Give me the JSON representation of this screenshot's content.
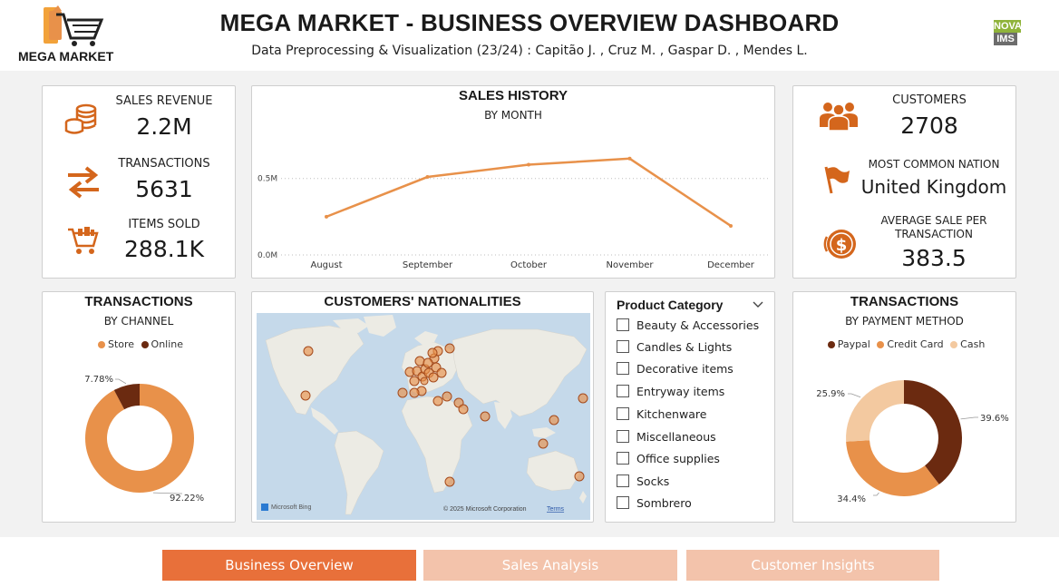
{
  "header": {
    "logo_text": "MEGA MARKET",
    "title": "MEGA MARKET - BUSINESS OVERVIEW DASHBOARD",
    "subtitle": "Data Preprocessing & Visualization (23/24) : Capitão J. ,  Cruz M. ,  Gaspar D. ,  Mendes L.",
    "badge_top": "NOVA",
    "badge_bottom": "IMS"
  },
  "kpis_left": {
    "revenue_label": "SALES REVENUE",
    "revenue_value": "2.2M",
    "transactions_label": "TRANSACTIONS",
    "transactions_value": "5631",
    "items_label": "ITEMS SOLD",
    "items_value": "288.1K"
  },
  "kpis_right": {
    "customers_label": "CUSTOMERS",
    "customers_value": "2708",
    "nation_label": "MOST COMMON NATION",
    "nation_value": "United Kingdom",
    "avg_label_1": "AVERAGE SALE PER",
    "avg_label_2": "TRANSACTION",
    "avg_value": "383.5"
  },
  "chart_data": [
    {
      "type": "line",
      "title": "SALES HISTORY",
      "subtitle": "BY MONTH",
      "categories": [
        "August",
        "September",
        "October",
        "November",
        "December"
      ],
      "values": [
        0.25,
        0.51,
        0.59,
        0.63,
        0.19
      ],
      "y_ticks": [
        "0.0M",
        "0.5M"
      ],
      "ylim": [
        0,
        0.7
      ],
      "unit": "M",
      "color": "#e8914a",
      "grid": true
    },
    {
      "type": "pie",
      "title": "TRANSACTIONS",
      "subtitle": "BY CHANNEL",
      "labels": [
        "Store",
        "Online"
      ],
      "values": [
        92.22,
        7.78
      ],
      "value_labels": [
        "92.22%",
        "7.78%"
      ],
      "colors": [
        "#e8914a",
        "#6b2a10"
      ],
      "legend": "top"
    },
    {
      "type": "pie",
      "title": "TRANSACTIONS",
      "subtitle": "BY PAYMENT METHOD",
      "labels": [
        "Paypal",
        "Credit Card",
        "Cash"
      ],
      "values": [
        39.6,
        34.4,
        25.9
      ],
      "value_labels": [
        "39.6%",
        "34.4%",
        "25.9%"
      ],
      "colors": [
        "#6b2a10",
        "#e8914a",
        "#f3c9a0"
      ],
      "legend": "top"
    }
  ],
  "map": {
    "title": "CUSTOMERS' NATIONALITIES",
    "attribution": "© 2025 Microsoft Corporation",
    "terms": "Terms",
    "brand": "Microsoft Bing"
  },
  "slicer": {
    "title": "Product Category",
    "items": [
      "Beauty & Accessories",
      "Candles & Lights",
      "Decorative items",
      "Entryway items",
      "Kitchenware",
      "Miscellaneous",
      "Office supplies",
      "Socks",
      "Sombrero"
    ]
  },
  "tabs": [
    {
      "label": "Business Overview"
    },
    {
      "label": "Sales Analysis"
    },
    {
      "label": "Customer Insights"
    }
  ],
  "colors": {
    "accent": "#e8914a",
    "dark": "#6b2a10",
    "light": "#f3c9a0",
    "tab_active": "#e8703a",
    "tab_inactive": "#f3c3ab"
  },
  "icons": {
    "revenue": "coins-icon",
    "transactions": "exchange-arrows-icon",
    "items": "shopping-cart-icon",
    "customers": "people-icon",
    "nation": "flag-icon",
    "avg_sale": "dollar-coin-icon"
  }
}
